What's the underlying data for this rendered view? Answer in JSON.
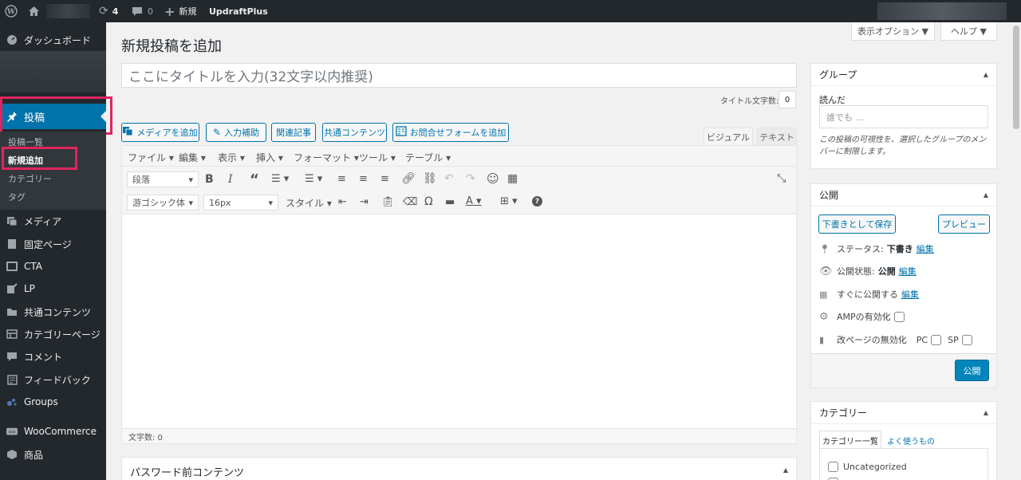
{
  "admin_bar": {
    "updates_count": "4",
    "comments_count": "0",
    "new_label": "新規",
    "plugin_label": "UpdraftPlus"
  },
  "sidebar": {
    "dashboard": "ダッシュボード",
    "posts": "投稿",
    "posts_sub": [
      "投稿一覧",
      "新規追加",
      "カテゴリー",
      "タグ"
    ],
    "media": "メディア",
    "pages": "固定ページ",
    "cta": "CTA",
    "lp": "LP",
    "shared": "共通コンテンツ",
    "category_page": "カテゴリーページ",
    "comments": "コメント",
    "feedback": "フィードバック",
    "groups": "Groups",
    "woocommerce": "WooCommerce",
    "products": "商品"
  },
  "screen_options": "表示オプション ▼",
  "help": "ヘルプ ▼",
  "page_title": "新規投稿を追加",
  "title_placeholder": "ここにタイトルを入力(32文字以内推奨)",
  "title_count_label": "タイトル文字数:",
  "title_count": "0",
  "editor_buttons": {
    "media": "メディアを追加",
    "assist": "入力補助",
    "related": "関連記事",
    "shared": "共通コンテンツ",
    "form": "お問合せフォームを追加"
  },
  "editor_tabs": {
    "visual": "ビジュアル",
    "text": "テキスト"
  },
  "menubar": [
    "ファイル ▾",
    "編集 ▾",
    "表示 ▾",
    "挿入 ▾",
    "フォーマット ▾",
    "ツール ▾",
    "テーブル ▾"
  ],
  "toolbar": {
    "paragraph": "段落",
    "font": "游ゴシック体",
    "size": "16px",
    "style": "スタイル"
  },
  "word_count": "文字数: 0",
  "password_box": "パスワード前コンテンツ",
  "group_panel": {
    "title": "グループ",
    "label": "読んだ",
    "placeholder": "誰でも …",
    "note": "この投稿の可視性を、選択したグループのメンバーに制限します。"
  },
  "publish_panel": {
    "title": "公開",
    "save_draft": "下書きとして保存",
    "preview": "プレビュー",
    "status_label": "ステータス:",
    "status_value": "下書き",
    "visibility_label": "公開状態:",
    "visibility_value": "公開",
    "schedule_label": "すぐに公開する",
    "edit": "編集",
    "amp_label": "AMPの有効化",
    "pagebreak_label": "改ページの無効化",
    "pc": "PC",
    "sp": "SP",
    "publish": "公開"
  },
  "category_panel": {
    "title": "カテゴリー",
    "tab_all": "カテゴリー一覧",
    "tab_popular": "よく使うもの",
    "items": [
      "Uncategorized"
    ]
  },
  "colors": {
    "accent": "#0073aa",
    "highlight": "#e0245e",
    "sidebar": "#23282d",
    "adminbar": "#23282d"
  }
}
